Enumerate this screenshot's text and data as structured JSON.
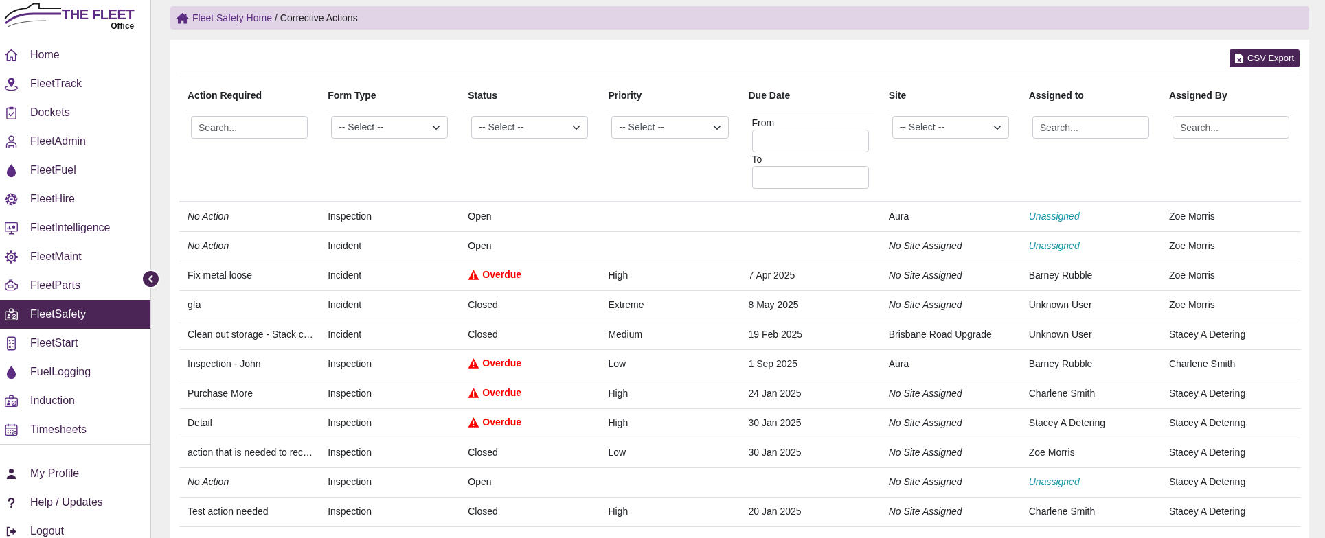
{
  "logo": {
    "title": "THE FLEET",
    "subtitle": "Office"
  },
  "sidebar": {
    "items": [
      {
        "label": "Home",
        "selected": false
      },
      {
        "label": "FleetTrack",
        "selected": false
      },
      {
        "label": "Dockets",
        "selected": false
      },
      {
        "label": "FleetAdmin",
        "selected": false
      },
      {
        "label": "FleetFuel",
        "selected": false
      },
      {
        "label": "FleetHire",
        "selected": false
      },
      {
        "label": "FleetIntelligence",
        "selected": false
      },
      {
        "label": "FleetMaint",
        "selected": false
      },
      {
        "label": "FleetParts",
        "selected": false
      },
      {
        "label": "FleetSafety",
        "selected": true
      },
      {
        "label": "FleetStart",
        "selected": false
      },
      {
        "label": "FuelLogging",
        "selected": false
      },
      {
        "label": "Induction",
        "selected": false
      },
      {
        "label": "Timesheets",
        "selected": false
      }
    ],
    "account_items": [
      {
        "label": "My Profile"
      },
      {
        "label": "Help / Updates"
      },
      {
        "label": "Logout"
      }
    ]
  },
  "breadcrumb": {
    "home_link": "Fleet Safety Home",
    "separator": "/",
    "current": "Corrective Actions"
  },
  "toolbar": {
    "export_button": "CSV Export"
  },
  "table": {
    "columns": [
      {
        "label": "Action Required",
        "filter": {
          "kind": "search",
          "placeholder": "Search..."
        }
      },
      {
        "label": "Form Type",
        "filter": {
          "kind": "select",
          "value": "-- Select --"
        }
      },
      {
        "label": "Status",
        "filter": {
          "kind": "select",
          "value": "-- Select --"
        }
      },
      {
        "label": "Priority",
        "filter": {
          "kind": "select",
          "value": "-- Select --"
        }
      },
      {
        "label": "Due Date",
        "filter": {
          "kind": "date_range",
          "from_label": "From",
          "to_label": "To"
        }
      },
      {
        "label": "Site",
        "filter": {
          "kind": "select",
          "value": "-- Select --"
        }
      },
      {
        "label": "Assigned to",
        "filter": {
          "kind": "search",
          "placeholder": "Search..."
        }
      },
      {
        "label": "Assigned By",
        "filter": {
          "kind": "search",
          "placeholder": "Search..."
        }
      }
    ],
    "rows": [
      {
        "action_required": "No Action",
        "action_missing": true,
        "form_type": "Inspection",
        "status": "Open",
        "overdue": false,
        "site": "Aura",
        "site_missing": false,
        "assigned_to": "Unassigned",
        "assignee_missing": true,
        "assigned_by": "Zoe Morris"
      },
      {
        "action_required": "No Action",
        "action_missing": true,
        "form_type": "Incident",
        "status": "Open",
        "overdue": false,
        "site": "No Site Assigned",
        "site_missing": true,
        "assigned_to": "Unassigned",
        "assignee_missing": true,
        "assigned_by": "Zoe Morris"
      },
      {
        "action_required": "Fix metal loose",
        "action_missing": false,
        "form_type": "Incident",
        "status": "Overdue",
        "overdue": true,
        "priority": "High",
        "due_date": "7 Apr 2025",
        "site": "No Site Assigned",
        "site_missing": true,
        "assigned_to": "Barney Rubble",
        "assignee_missing": false,
        "assigned_by": "Zoe Morris"
      },
      {
        "action_required": "gfa",
        "action_missing": false,
        "form_type": "Incident",
        "status": "Closed",
        "overdue": false,
        "priority": "Extreme",
        "due_date": "8 May 2025",
        "site": "No Site Assigned",
        "site_missing": true,
        "assigned_to": "Unknown User",
        "assignee_missing": false,
        "assigned_by": "Zoe Morris"
      },
      {
        "action_required": "Clean out storage - Stack c…",
        "action_missing": false,
        "form_type": "Incident",
        "status": "Closed",
        "overdue": false,
        "priority": "Medium",
        "due_date": "19 Feb 2025",
        "site": "Brisbane Road Upgrade",
        "site_missing": false,
        "assigned_to": "Unknown User",
        "assignee_missing": false,
        "assigned_by": "Stacey A Detering"
      },
      {
        "action_required": "Inspection - John",
        "action_missing": false,
        "form_type": "Inspection",
        "status": "Overdue",
        "overdue": true,
        "priority": "Low",
        "due_date": "1 Sep 2025",
        "site": "Aura",
        "site_missing": false,
        "assigned_to": "Barney Rubble",
        "assignee_missing": false,
        "assigned_by": "Charlene Smith"
      },
      {
        "action_required": "Purchase More",
        "action_missing": false,
        "form_type": "Inspection",
        "status": "Overdue",
        "overdue": true,
        "priority": "High",
        "due_date": "24 Jan 2025",
        "site": "No Site Assigned",
        "site_missing": true,
        "assigned_to": "Charlene Smith",
        "assignee_missing": false,
        "assigned_by": "Stacey A Detering"
      },
      {
        "action_required": "Detail",
        "action_missing": false,
        "form_type": "Inspection",
        "status": "Overdue",
        "overdue": true,
        "priority": "High",
        "due_date": "30 Jan 2025",
        "site": "No Site Assigned",
        "site_missing": true,
        "assigned_to": "Stacey A Detering",
        "assignee_missing": false,
        "assigned_by": "Stacey A Detering"
      },
      {
        "action_required": "action that is needed to rec…",
        "action_missing": false,
        "form_type": "Inspection",
        "status": "Closed",
        "overdue": false,
        "priority": "Low",
        "due_date": "30 Jan 2025",
        "site": "No Site Assigned",
        "site_missing": true,
        "assigned_to": "Zoe Morris",
        "assignee_missing": false,
        "assigned_by": "Stacey A Detering"
      },
      {
        "action_required": "No Action",
        "action_missing": true,
        "form_type": "Inspection",
        "status": "Open",
        "overdue": false,
        "site": "No Site Assigned",
        "site_missing": true,
        "assigned_to": "Unassigned",
        "assignee_missing": true,
        "assigned_by": "Stacey A Detering"
      },
      {
        "action_required": "Test action needed",
        "action_missing": false,
        "form_type": "Inspection",
        "status": "Closed",
        "overdue": false,
        "priority": "High",
        "due_date": "20 Jan 2025",
        "site": "No Site Assigned",
        "site_missing": true,
        "assigned_to": "Charlene Smith",
        "assignee_missing": false,
        "assigned_by": "Stacey A Detering"
      }
    ]
  }
}
